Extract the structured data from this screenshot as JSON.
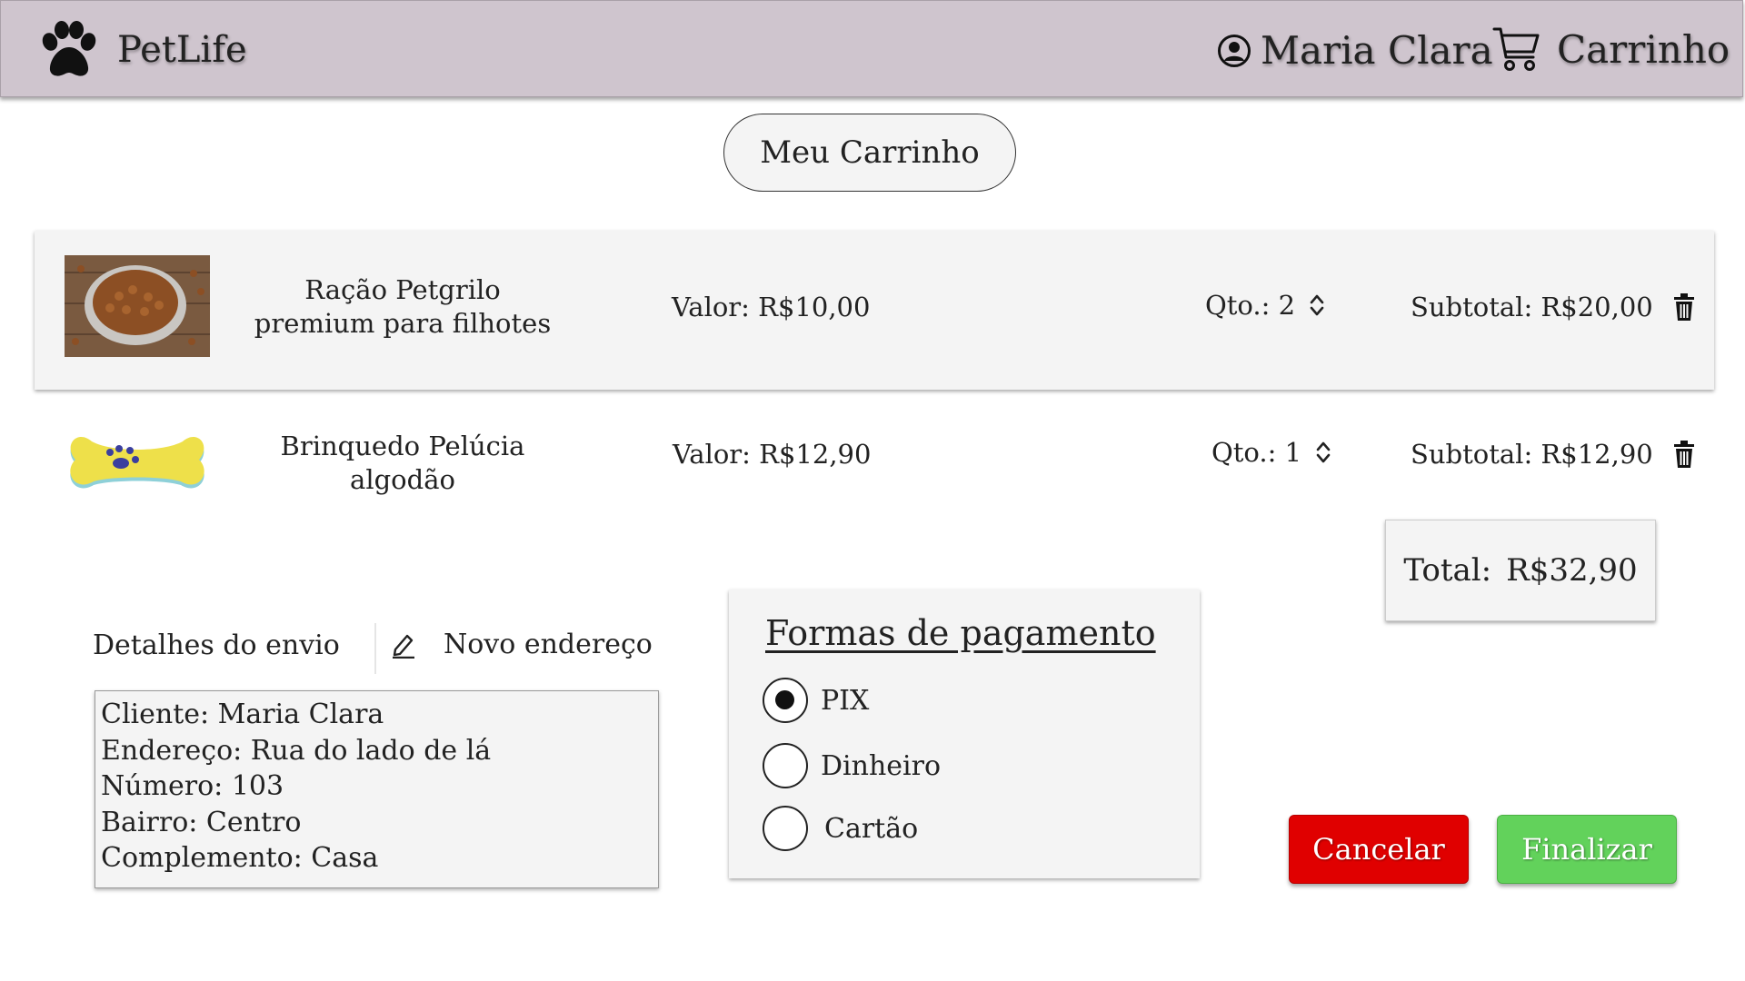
{
  "header": {
    "brand": "PetLife",
    "user_name": "Maria Clara",
    "cart_label": "Carrinho"
  },
  "page_title": "Meu Carrinho",
  "cart_items": [
    {
      "name_line1": "Ração Petgrilo",
      "name_line2": "premium para filhotes",
      "price_label": "Valor: R$10,00",
      "qty_label": "Qto.: 2",
      "subtotal_label": "Subtotal: R$20,00",
      "image": "dog-food-bowl"
    },
    {
      "name_line1": "Brinquedo Pelúcia",
      "name_line2": "algodão",
      "price_label": "Valor: R$12,90",
      "qty_label": "Qto.: 1",
      "subtotal_label": "Subtotal: R$12,90",
      "image": "plush-bone-toy"
    }
  ],
  "total": {
    "label": "Total:",
    "value": "R$32,90"
  },
  "shipping": {
    "title": "Detalhes do envio",
    "new_address_label": "Novo endereço",
    "lines": [
      "Cliente: Maria Clara",
      "Endereço: Rua do lado de lá",
      "Número: 103",
      "Bairro: Centro",
      "Complemento: Casa"
    ]
  },
  "payment": {
    "title": "Formas de pagamento",
    "options": [
      "PIX",
      "Dinheiro",
      "Cartão"
    ],
    "selected": "PIX"
  },
  "actions": {
    "cancel_label": "Cancelar",
    "finish_label": "Finalizar"
  },
  "colors": {
    "header_bg": "#cfc5ce",
    "cancel": "#e00000",
    "finish": "#62d25b",
    "panel": "#f4f4f4"
  }
}
